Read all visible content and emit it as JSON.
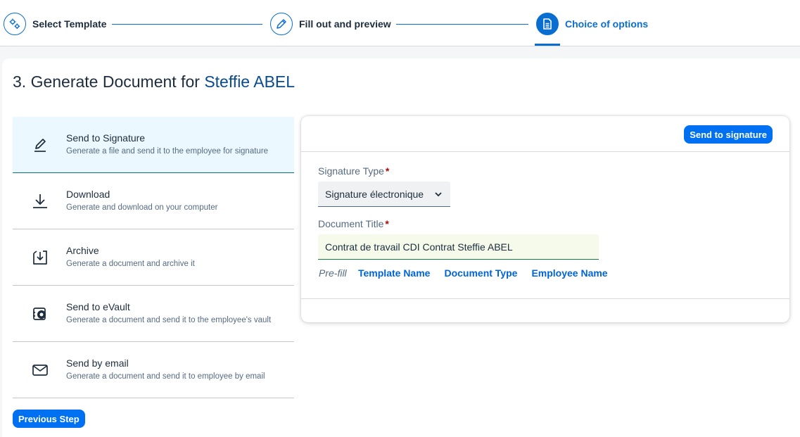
{
  "wizard": {
    "steps": [
      {
        "label": "Select Template",
        "icon": "gears-icon",
        "state": "done"
      },
      {
        "label": "Fill out and preview",
        "icon": "edit-icon",
        "state": "done"
      },
      {
        "label": "Choice of options",
        "icon": "document-icon",
        "state": "active"
      }
    ]
  },
  "page": {
    "title_prefix": "3. Generate Document for",
    "employee_name": "Steffie ABEL"
  },
  "options": [
    {
      "title": "Send to Signature",
      "description": "Generate a file and send it to the employee for signature",
      "icon": "pen-icon",
      "selected": true
    },
    {
      "title": "Download",
      "description": "Generate and download on your computer",
      "icon": "download-icon",
      "selected": false
    },
    {
      "title": "Archive",
      "description": "Generate a document and archive it",
      "icon": "archive-icon",
      "selected": false
    },
    {
      "title": "Send to eVault",
      "description": "Generate a document and send it to the employee's vault",
      "icon": "vault-icon",
      "selected": false
    },
    {
      "title": "Send by email",
      "description": "Generate a document and send it to employee by email",
      "icon": "email-icon",
      "selected": false
    }
  ],
  "buttons": {
    "previous_step": "Previous Step",
    "send_to_signature": "Send to signature"
  },
  "form": {
    "signature_type_label": "Signature Type",
    "signature_type_value": "Signature électronique",
    "document_title_label": "Document Title",
    "document_title_value": "Contrat de travail CDI Contrat Steffie ABEL",
    "required_mark": "*",
    "prefill_label": "Pre-fill",
    "prefill_links": [
      "Template Name",
      "Document Type",
      "Employee Name"
    ]
  },
  "colors": {
    "accent": "#0070f2",
    "selected_bg": "#ebf8ff",
    "input_success_bg": "#f5faeb",
    "required": "#aa0808"
  }
}
